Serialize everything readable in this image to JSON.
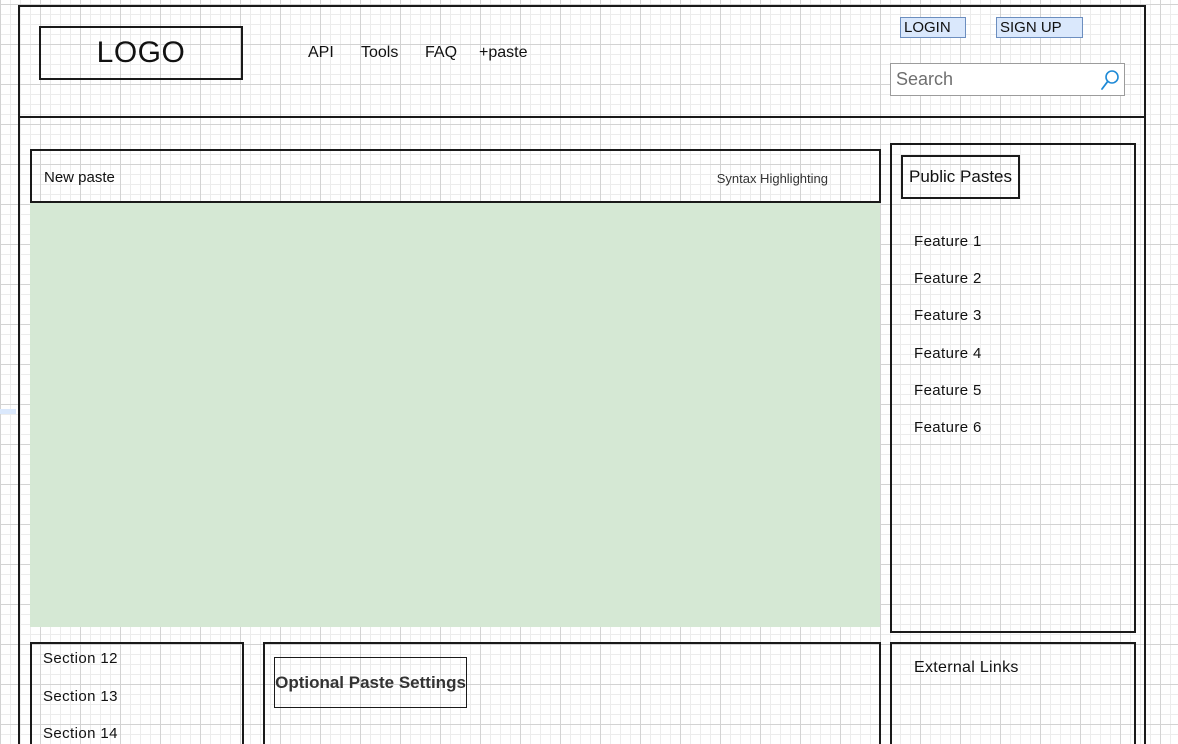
{
  "header": {
    "logo": "LOGO",
    "nav": [
      "API",
      "Tools",
      "FAQ",
      "+paste"
    ],
    "login_label": "LOGIN",
    "signup_label": "SIGN UP",
    "search_placeholder": "Search"
  },
  "paste": {
    "title": "New paste",
    "syntax_label": "Syntax Highlighting",
    "content": ""
  },
  "public_pastes": {
    "title": "Public Pastes",
    "items": [
      "Feature 1",
      "Feature 2",
      "Feature 3",
      "Feature 4",
      "Feature 5",
      "Feature 6"
    ]
  },
  "sections": [
    "Section 12",
    "Section 13",
    "Section 14"
  ],
  "settings": {
    "title": "Optional Paste Settings"
  },
  "external_links": {
    "title": "External Links"
  },
  "colors": {
    "paste_area": "#d5e8d4",
    "button_fill": "#dae8fc",
    "button_border": "#6c8ebf",
    "search_icon": "#1f8ad6"
  },
  "icons": {
    "search": "search-icon"
  }
}
